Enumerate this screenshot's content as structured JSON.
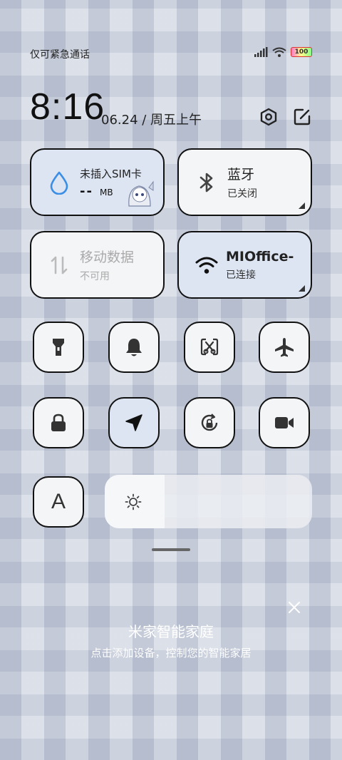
{
  "status_bar": {
    "carrier_text": "仅可紧急通话",
    "battery_level": "100",
    "icons": [
      "signal-icon",
      "wifi-icon",
      "battery-icon"
    ]
  },
  "header": {
    "time": "8:16",
    "date": "06.24 / 周五上午",
    "icons": [
      "settings-icon",
      "edit-icon"
    ]
  },
  "tiles": {
    "data_usage": {
      "title": "未插入SIM卡",
      "value": "--",
      "unit": "MB",
      "icon": "water-drop-icon"
    },
    "bluetooth": {
      "title": "蓝牙",
      "status": "已关闭",
      "icon": "bluetooth-icon"
    },
    "mobile_data": {
      "title": "移动数据",
      "status": "不可用",
      "icon": "mobile-data-icon"
    },
    "wifi": {
      "title": "MIOffice-",
      "status": "已连接",
      "icon": "wifi-icon"
    }
  },
  "toggles_row1": [
    "flashlight-icon",
    "bell-icon",
    "screenshot-icon",
    "airplane-icon"
  ],
  "toggles_row2": [
    "lock-icon",
    "location-icon",
    "rotation-lock-icon",
    "video-icon"
  ],
  "font_toggle": {
    "label": "A"
  },
  "brightness": {
    "level": 0.29,
    "icon": "sun-icon"
  },
  "mijia": {
    "title": "米家智能家庭",
    "subtitle": "点击添加设备，控制您的智能家居"
  },
  "colors": {
    "active_tile": "#dde5f3",
    "tile": "#f4f5f7",
    "border": "#111111",
    "accent": "#3a8ee6"
  }
}
